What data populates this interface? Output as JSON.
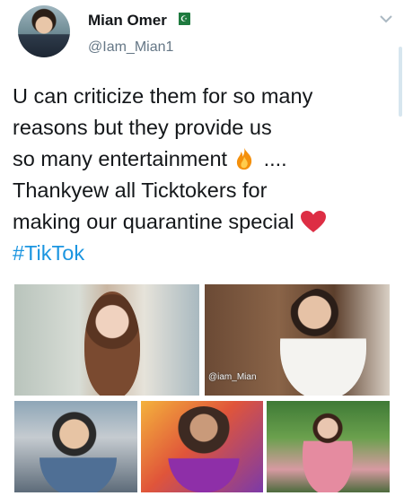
{
  "author": {
    "display_name": "Mian Omer",
    "handle": "@Iam_Mian1",
    "flag_icon": "pakistan-flag-icon"
  },
  "tweet": {
    "lines": [
      "U can criticize them for so many",
      "reasons but they provide us",
      "so many entertainment",
      "....",
      "Thankyew all Ticktokers for",
      "making our quarantine special"
    ],
    "hashtag": "#TikTok"
  },
  "media": {
    "watermark": "@iam_Mian",
    "photos": [
      {
        "name": "photo-woman-long-hair"
      },
      {
        "name": "photo-man-white-shirt"
      },
      {
        "name": "photo-man-denim-jacket"
      },
      {
        "name": "photo-bearded-man"
      },
      {
        "name": "photo-woman-pink-dress"
      }
    ]
  },
  "colors": {
    "link": "#1b95e0",
    "muted": "#657786",
    "text": "#14171a"
  }
}
